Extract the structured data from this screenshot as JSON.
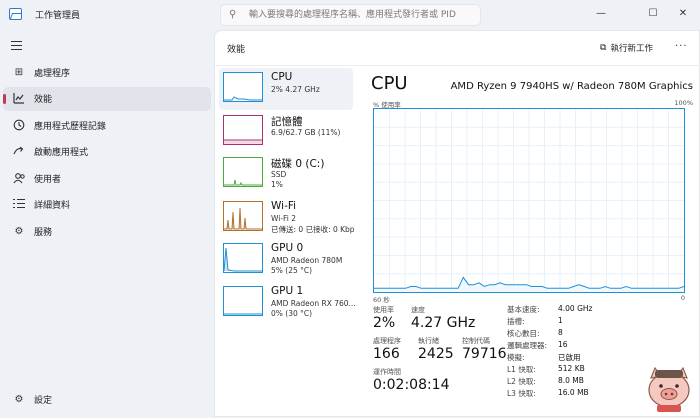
{
  "app": {
    "title": "工作管理員"
  },
  "search": {
    "placeholder": "輸入要搜尋的處理程序名稱、應用程式發行者或 PID"
  },
  "window_controls": {
    "minimize": "—",
    "maximize": "☐",
    "close": "✕"
  },
  "nav": {
    "items": [
      {
        "label": "處理程序",
        "icon": "processes-grid-icon",
        "active": false
      },
      {
        "label": "效能",
        "icon": "performance-chart-icon",
        "active": true
      },
      {
        "label": "應用程式歷程記錄",
        "icon": "history-icon",
        "active": false
      },
      {
        "label": "啟動應用程式",
        "icon": "startup-icon",
        "active": false
      },
      {
        "label": "使用者",
        "icon": "users-icon",
        "active": false
      },
      {
        "label": "詳細資料",
        "icon": "details-list-icon",
        "active": false
      },
      {
        "label": "服務",
        "icon": "services-icon",
        "active": false
      }
    ],
    "settings": "設定"
  },
  "header": {
    "title": "效能",
    "run_task": "執行新工作",
    "more": "···"
  },
  "devices": [
    {
      "name": "CPU",
      "line1": "2% 4.27 GHz",
      "line2": "",
      "line3": "",
      "color": "#1f8fd6"
    },
    {
      "name": "記憶體",
      "line1": "6.9/62.7 GB (11%)",
      "line2": "",
      "line3": "",
      "color": "#a8336f"
    },
    {
      "name": "磁碟 0 (C:)",
      "line1": "SSD",
      "line2": "1%",
      "line3": "",
      "color": "#4caa3c"
    },
    {
      "name": "Wi-Fi",
      "line1": "Wi-Fi 2",
      "line2": "已傳送: 0 已接收: 0 Kbps",
      "line3": "",
      "color": "#b0722e"
    },
    {
      "name": "GPU 0",
      "line1": "AMD Radeon 780M",
      "line2": "5% (25 °C)",
      "line3": "",
      "color": "#1f8fd6"
    },
    {
      "name": "GPU 1",
      "line1": "AMD Radeon RX 760...",
      "line2": "0% (30 °C)",
      "line3": "",
      "color": "#1f8fd6"
    }
  ],
  "cpu": {
    "title": "CPU",
    "model": "AMD Ryzen 9 7940HS w/ Radeon 780M Graphics",
    "usage_axis_label": "% 使用率",
    "max_label": "100%",
    "time_label": "60 秒",
    "min_label": "0",
    "utilization_history_pct": [
      2,
      2,
      2,
      2,
      2,
      2,
      2,
      3,
      3,
      2,
      2,
      2,
      2,
      2,
      2,
      2,
      2,
      8,
      4,
      4,
      5,
      3,
      4,
      4,
      5,
      4,
      4,
      4,
      4,
      4,
      3,
      3,
      3,
      2,
      2,
      2,
      2,
      2,
      3,
      4,
      3,
      2,
      2,
      2,
      3,
      2,
      2,
      2,
      3,
      2,
      2,
      2,
      2,
      2,
      2,
      2,
      2,
      2,
      2,
      3
    ],
    "stats": {
      "utilization_label": "使用率",
      "utilization": "2%",
      "speed_label": "速度",
      "speed": "4.27 GHz",
      "processes_label": "處理程序",
      "processes": "166",
      "threads_label": "執行緒",
      "threads": "2425",
      "handles_label": "控制代碼",
      "handles": "79716",
      "uptime_label": "運作時間",
      "uptime": "0:02:08:14"
    },
    "specs": [
      {
        "label": "基本速度:",
        "value": "4.00 GHz"
      },
      {
        "label": "插槽:",
        "value": "1"
      },
      {
        "label": "核心數目:",
        "value": "8"
      },
      {
        "label": "邏輯處理器:",
        "value": "16"
      },
      {
        "label": "模擬:",
        "value": "已啟用"
      },
      {
        "label": "L1 快取:",
        "value": "512 KB"
      },
      {
        "label": "L2 快取:",
        "value": "8.0 MB"
      },
      {
        "label": "L3 快取:",
        "value": "16.0 MB"
      }
    ]
  }
}
